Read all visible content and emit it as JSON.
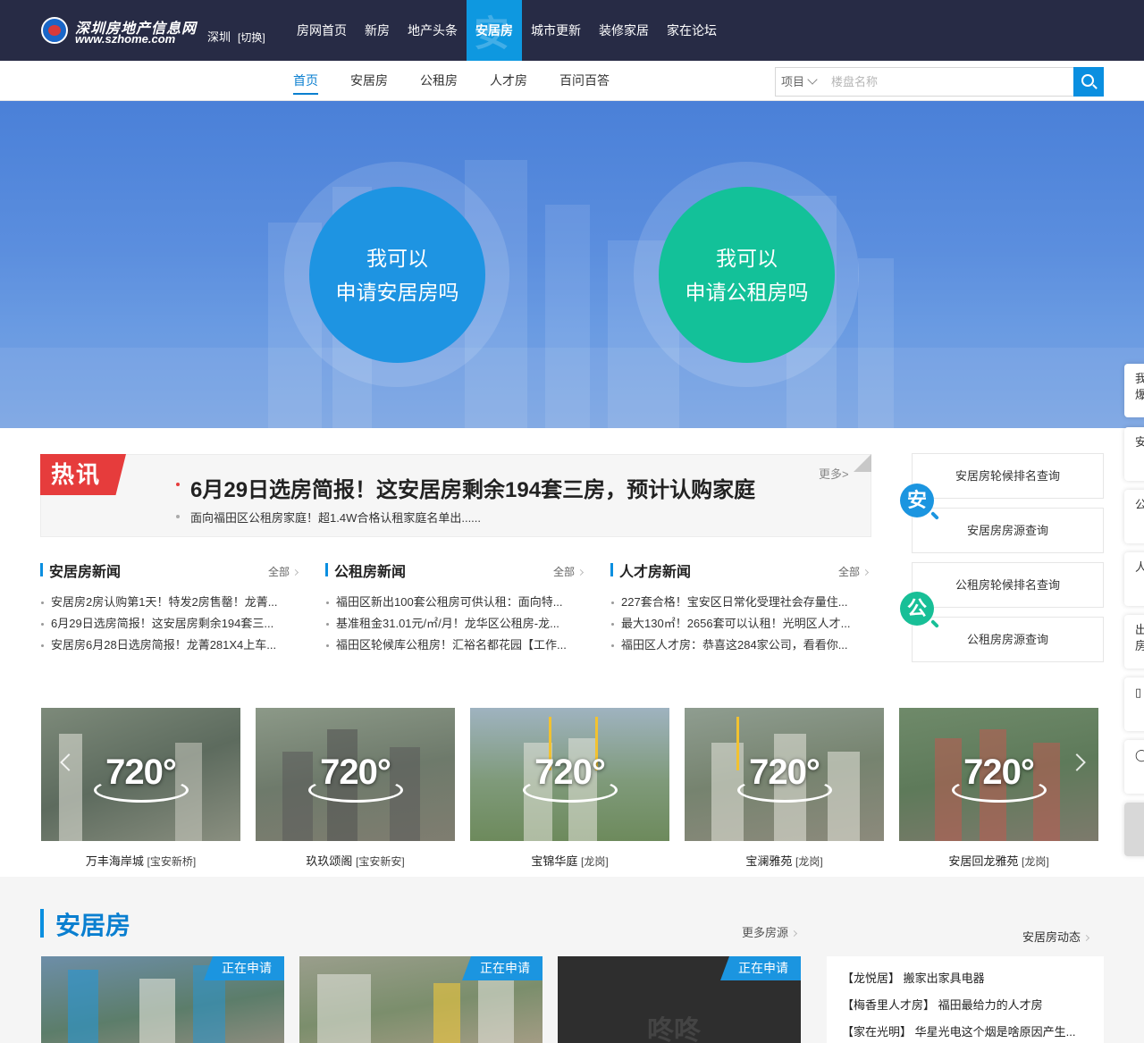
{
  "header": {
    "logo_cn": "深圳房地产信息网",
    "logo_en": "www.szhome.com",
    "city": "深圳",
    "city_switch": "[切换]",
    "nav": [
      {
        "label": "房网首页"
      },
      {
        "label": "新房"
      },
      {
        "label": "地产头条"
      },
      {
        "label": "安居房",
        "ghost": "安"
      },
      {
        "label": "城市更新"
      },
      {
        "label": "装修家居"
      },
      {
        "label": "家在论坛"
      }
    ]
  },
  "subnav": {
    "links": [
      "首页",
      "安居房",
      "公租房",
      "人才房",
      "百问百答"
    ],
    "search_type": "项目",
    "search_placeholder": "楼盘名称"
  },
  "banner": {
    "left": {
      "line1": "我可以",
      "line2": "申请安居房吗"
    },
    "right": {
      "line1": "我可以",
      "line2": "申请公租房吗"
    }
  },
  "side_tabs": [
    "我要\n爆料",
    "安",
    "公",
    "人",
    "出\n房",
    "",
    "",
    ""
  ],
  "hot": {
    "tag": "热讯",
    "title": "6月29日选房简报！这安居房剩余194套三房，预计认购家庭",
    "sub": "面向福田区公租房家庭！超1.4W合格认租家庭名单出......",
    "more": "更多>"
  },
  "news_columns": [
    {
      "title": "安居房新闻",
      "all": "全部",
      "items": [
        "安居房2房认购第1天！特发2房售罄！龙菁...",
        "6月29日选房简报！这安居房剩余194套三...",
        "安居房6月28日选房简报！龙菁281X4上车..."
      ]
    },
    {
      "title": "公租房新闻",
      "all": "全部",
      "items": [
        "福田区新出100套公租房可供认租：面向特...",
        "基准租金31.01元/㎡/月！龙华区公租房-龙...",
        "福田区轮候库公租房！汇裕名都花园【工作..."
      ]
    },
    {
      "title": "人才房新闻",
      "all": "全部",
      "items": [
        "227套合格！宝安区日常化受理社会存量住...",
        "最大130㎡！2656套可以认租！光明区人才...",
        "福田区人才房：恭喜这284家公司，看看你..."
      ]
    }
  ],
  "query": {
    "anju_icon": "安",
    "gongzu_icon": "公",
    "buttons": [
      "安居房轮候排名查询",
      "安居房房源查询",
      "公租房轮候排名查询",
      "公租房房源查询"
    ]
  },
  "gallery": {
    "badge": "720°",
    "items": [
      {
        "name": "万丰海岸城",
        "area": "[宝安新桥]"
      },
      {
        "name": "玖玖颂阁",
        "area": "[宝安新安]"
      },
      {
        "name": "宝锦华庭",
        "area": "[龙岗]"
      },
      {
        "name": "宝澜雅苑",
        "area": "[龙岗]"
      },
      {
        "name": "安居回龙雅苑",
        "area": "[龙岗]"
      }
    ]
  },
  "anju_section": {
    "title": "安居房",
    "more": "更多房源",
    "projects": [
      {
        "status": "正在申请"
      },
      {
        "status": "正在申请"
      },
      {
        "status": "正在申请",
        "watermark": "咚咚"
      }
    ],
    "dynamics_title": "安居房动态",
    "dynamics": [
      "【龙悦居】 搬家出家具电器",
      "【梅香里人才房】 福田最给力的人才房",
      "【家在光明】 华星光电这个烟是啥原因产生..."
    ]
  },
  "colors": {
    "topbar": "#272b45",
    "accent_blue": "#0a8fe0",
    "accent_green": "#13c199",
    "hot_red": "#e63c3c"
  }
}
